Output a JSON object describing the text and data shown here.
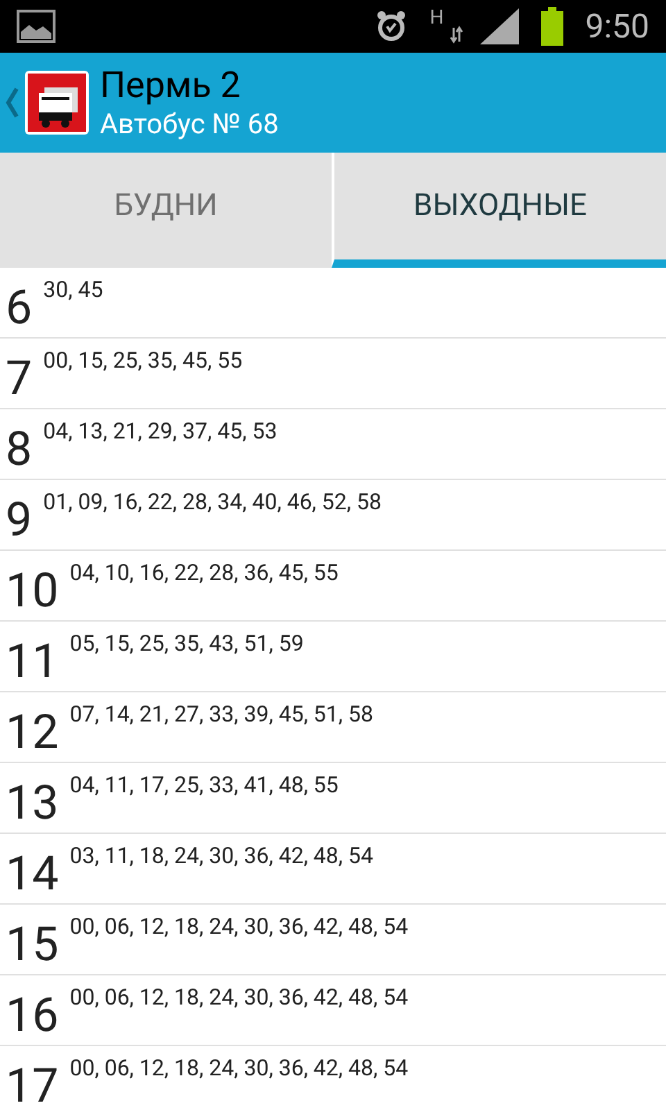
{
  "status_bar": {
    "time": "9:50",
    "network": "H"
  },
  "header": {
    "title": "Пермь 2",
    "subtitle": "Автобус № 68"
  },
  "tabs": [
    {
      "label": "БУДНИ",
      "selected": false
    },
    {
      "label": "ВЫХОДНЫЕ",
      "selected": true
    }
  ],
  "rows": [
    {
      "hour": "6",
      "minutes": "30, 45"
    },
    {
      "hour": "7",
      "minutes": "00, 15, 25, 35, 45, 55"
    },
    {
      "hour": "8",
      "minutes": "04, 13, 21, 29, 37, 45, 53"
    },
    {
      "hour": "9",
      "minutes": "01, 09, 16, 22, 28, 34, 40, 46, 52, 58"
    },
    {
      "hour": "10",
      "minutes": "04, 10, 16, 22, 28, 36, 45, 55"
    },
    {
      "hour": "11",
      "minutes": "05, 15, 25, 35, 43, 51, 59"
    },
    {
      "hour": "12",
      "minutes": "07, 14, 21, 27, 33, 39, 45, 51, 58"
    },
    {
      "hour": "13",
      "minutes": "04, 11, 17, 25, 33, 41, 48, 55"
    },
    {
      "hour": "14",
      "minutes": "03, 11, 18, 24, 30, 36, 42, 48, 54"
    },
    {
      "hour": "15",
      "minutes": "00, 06, 12, 18, 24, 30, 36, 42, 48, 54"
    },
    {
      "hour": "16",
      "minutes": "00, 06, 12, 18, 24, 30, 36, 42, 48, 54"
    },
    {
      "hour": "17",
      "minutes": "00, 06, 12, 18, 24, 30, 36, 42, 48, 54"
    }
  ]
}
